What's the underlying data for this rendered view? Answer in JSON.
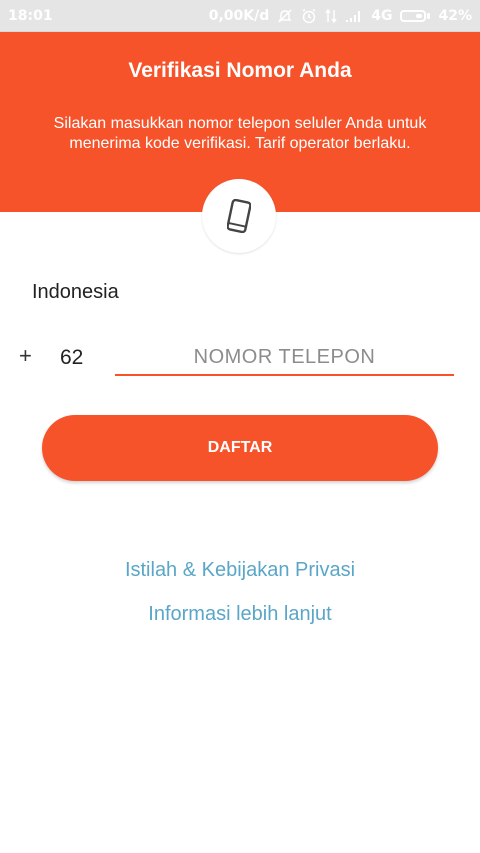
{
  "status_bar": {
    "time": "18:01",
    "speed": "0,00K/d",
    "network": "4G",
    "battery": "42%",
    "icons": [
      "no-notification-icon",
      "alarm-icon",
      "data-transfer-icon",
      "signal-icon",
      "battery-icon"
    ],
    "battery_level": 0.42
  },
  "header": {
    "title": "Verifikasi Nomor Anda",
    "subtitle": "Silakan masukkan nomor telepon seluler Anda untuk menerima kode verifikasi. Tarif operator berlaku."
  },
  "form": {
    "phone_icon": "smartphone-icon",
    "country": "Indonesia",
    "plus": "+",
    "country_code": "62",
    "phone_placeholder": "NOMOR TELEPON",
    "phone_value": ""
  },
  "actions": {
    "register_label": "DAFTAR"
  },
  "links": {
    "terms": "Istilah & Kebijakan Privasi",
    "info": "Informasi lebih lanjut"
  },
  "colors": {
    "accent": "#f6532b",
    "link": "#5aa6c8",
    "status_bar": "#e5e5e5"
  }
}
